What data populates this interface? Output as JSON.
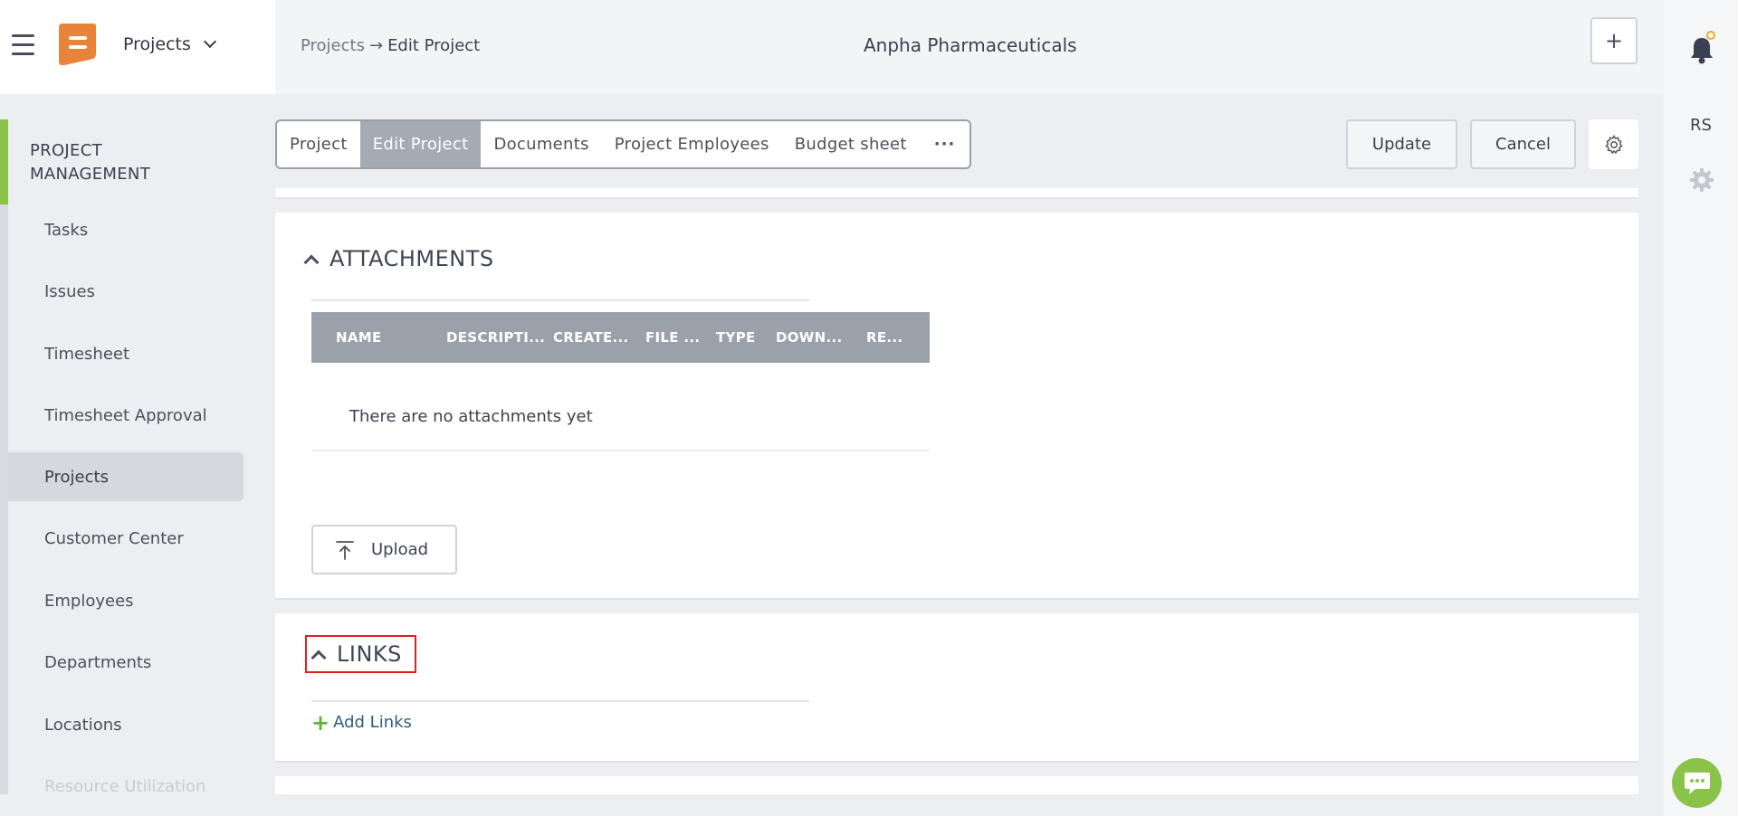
{
  "header": {
    "module": "Projects",
    "breadcrumb": {
      "parent": "Projects",
      "separator": "→",
      "current": "Edit Project"
    },
    "title": "Anpha Pharmaceuticals",
    "add_label": "+"
  },
  "rail": {
    "initials": "RS"
  },
  "sidebar": {
    "heading_line1": "PROJECT",
    "heading_line2": "MANAGEMENT",
    "items": [
      {
        "label": "Tasks"
      },
      {
        "label": "Issues"
      },
      {
        "label": "Timesheet"
      },
      {
        "label": "Timesheet Approval"
      },
      {
        "label": "Projects"
      },
      {
        "label": "Customer Center"
      },
      {
        "label": "Employees"
      },
      {
        "label": "Departments"
      },
      {
        "label": "Locations"
      },
      {
        "label": "Resource Utilization"
      }
    ]
  },
  "tabs": [
    {
      "label": "Project"
    },
    {
      "label": "Edit Project"
    },
    {
      "label": "Documents"
    },
    {
      "label": "Project Employees"
    },
    {
      "label": "Budget sheet"
    },
    {
      "label": "···"
    }
  ],
  "actions": {
    "update": "Update",
    "cancel": "Cancel"
  },
  "attachments": {
    "title": "ATTACHMENTS",
    "columns": [
      "NAME",
      "DESCRIPTI...",
      "CREATE...",
      "FILE ...",
      "TYPE",
      "DOWN...",
      "RE..."
    ],
    "empty_message": "There are no attachments yet",
    "upload_label": "Upload"
  },
  "links": {
    "title": "LINKS",
    "add_label": "Add Links"
  },
  "colors": {
    "accent_green": "#8bc34a",
    "brand_orange": "#e8833a",
    "highlight_red": "#e02020",
    "notification_dot": "#f5a623"
  }
}
